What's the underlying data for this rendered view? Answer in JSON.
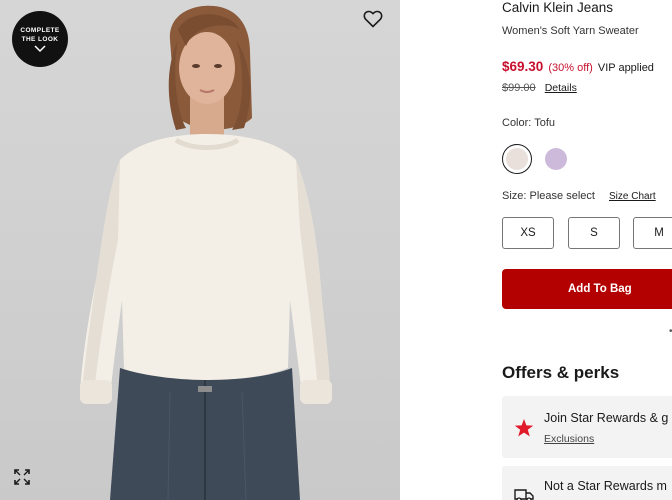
{
  "image": {
    "complete_look_line1": "COMPLETE",
    "complete_look_line2": "THE LOOK"
  },
  "product": {
    "brand": "Calvin Klein Jeans",
    "name": "Women's Soft Yarn Sweater",
    "sale_price": "$69.30",
    "discount": "(30% off)",
    "vip_text": "VIP applied",
    "original_price": "$99.00",
    "details_link": "Details"
  },
  "color": {
    "label": "Color: Tofu",
    "swatches": [
      {
        "name": "Tofu",
        "hex": "#e9dfdb",
        "selected": true
      },
      {
        "name": "Lilac",
        "hex": "#cdb9d9",
        "selected": false
      }
    ]
  },
  "size": {
    "label": "Size: Please select",
    "chart_link": "Size Chart",
    "options": [
      "XS",
      "S",
      "M"
    ]
  },
  "actions": {
    "add_to_bag": "Add To Bag"
  },
  "offers": {
    "title": "Offers & perks",
    "items": [
      {
        "title": "Join Star Rewards & g",
        "link": "Exclusions",
        "icon": "star-icon"
      },
      {
        "title": "Not a Star Rewards m",
        "icon": "truck-icon"
      }
    ]
  },
  "colors": {
    "accent_red": "#b30000",
    "sale_red": "#c8102e",
    "star_red": "#e01a2b"
  }
}
